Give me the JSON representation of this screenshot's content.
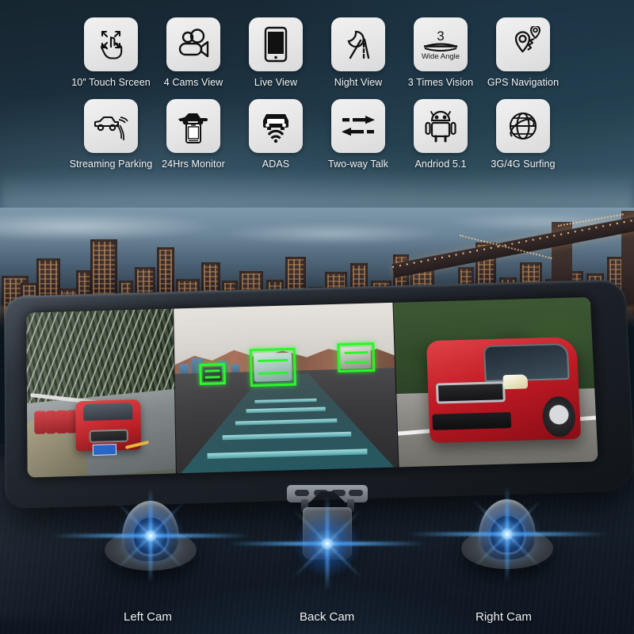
{
  "product": {
    "type": "car-rearview-mirror-dashcam",
    "mirror_screen": {
      "panes": [
        {
          "name": "left-camera-view",
          "scene": "snowy mountain road with red SUV"
        },
        {
          "name": "front-adas-view",
          "scene": "highway with green ADAS detection boxes and cyan lane overlay"
        },
        {
          "name": "right-camera-view",
          "scene": "red sedan on tree-lined road"
        }
      ]
    }
  },
  "features": {
    "row1": [
      {
        "id": "touch-screen",
        "label": "10″  Touch Srceen",
        "icon": "touch-gesture-icon"
      },
      {
        "id": "four-cams-view",
        "label": "4 Cams View",
        "icon": "video-camera-icon"
      },
      {
        "id": "live-view",
        "label": "Live View",
        "icon": "smartphone-icon"
      },
      {
        "id": "night-view",
        "label": "Night View",
        "icon": "moon-road-icon"
      },
      {
        "id": "three-times-vision",
        "label": "3 Times Vision",
        "icon": "wide-angle-lens-icon",
        "badge": "3",
        "caption": "Wide Angle"
      },
      {
        "id": "gps-navigation",
        "label": "GPS Navigation",
        "icon": "map-pins-route-icon"
      }
    ],
    "row2": [
      {
        "id": "streaming-parking",
        "label": "Streaming Parking",
        "icon": "car-parking-sensor-icon"
      },
      {
        "id": "24hrs-monitor",
        "label": "24Hrs Monitor",
        "icon": "car-phone-monitor-icon"
      },
      {
        "id": "adas",
        "label": "ADAS",
        "icon": "car-front-radar-icon"
      },
      {
        "id": "two-way-talk",
        "label": "Two-way Talk",
        "icon": "two-way-arrows-icon"
      },
      {
        "id": "android-version",
        "label": "Andriod 5.1",
        "icon": "android-robot-icon"
      },
      {
        "id": "network-surfing",
        "label": "3G/4G Surfing",
        "icon": "globe-network-icon"
      }
    ]
  },
  "cameras": [
    {
      "id": "left-cam",
      "label": "Left Cam",
      "type": "dome-camera"
    },
    {
      "id": "back-cam",
      "label": "Back Cam",
      "type": "license-plate-camera"
    },
    {
      "id": "right-cam",
      "label": "Right Cam",
      "type": "dome-camera"
    }
  ],
  "colors": {
    "background_top": "#16252f",
    "background_bottom": "#0d1520",
    "tile_bg": "#e8e8e8",
    "icon_stroke": "#111111",
    "label_text": "#f2f5f7",
    "adas_box": "#2bf52b",
    "lane_overlay": "#22bac8",
    "lens_flare": "#5ab4ff",
    "car_red": "#c01a24"
  }
}
